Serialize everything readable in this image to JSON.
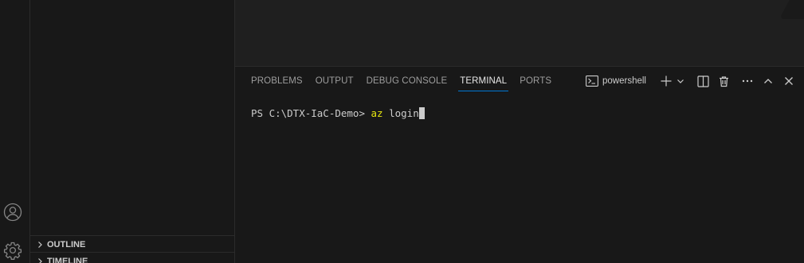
{
  "sidebar": {
    "sections": [
      {
        "label": "OUTLINE"
      },
      {
        "label": "TIMELINE"
      }
    ]
  },
  "activity_bar": {
    "icons": [
      "account-icon",
      "manage-gear-icon"
    ]
  },
  "panel": {
    "tabs": [
      {
        "label": "PROBLEMS",
        "active": false
      },
      {
        "label": "OUTPUT",
        "active": false
      },
      {
        "label": "DEBUG CONSOLE",
        "active": false
      },
      {
        "label": "TERMINAL",
        "active": true
      },
      {
        "label": "PORTS",
        "active": false
      }
    ],
    "terminal_profile": "powershell",
    "actions": [
      "new-terminal-icon",
      "launch-profile-chevron-icon",
      "split-terminal-icon",
      "kill-terminal-icon",
      "more-actions-icon",
      "maximize-panel-icon",
      "close-panel-icon"
    ]
  },
  "terminal": {
    "prompt": "PS C:\\DTX-IaC-Demo> ",
    "command": "az",
    "args": " login"
  },
  "colors": {
    "accent": "#0078d4",
    "command": "#e5e510",
    "background": "#181818",
    "editor_background": "#1f1f1f"
  }
}
